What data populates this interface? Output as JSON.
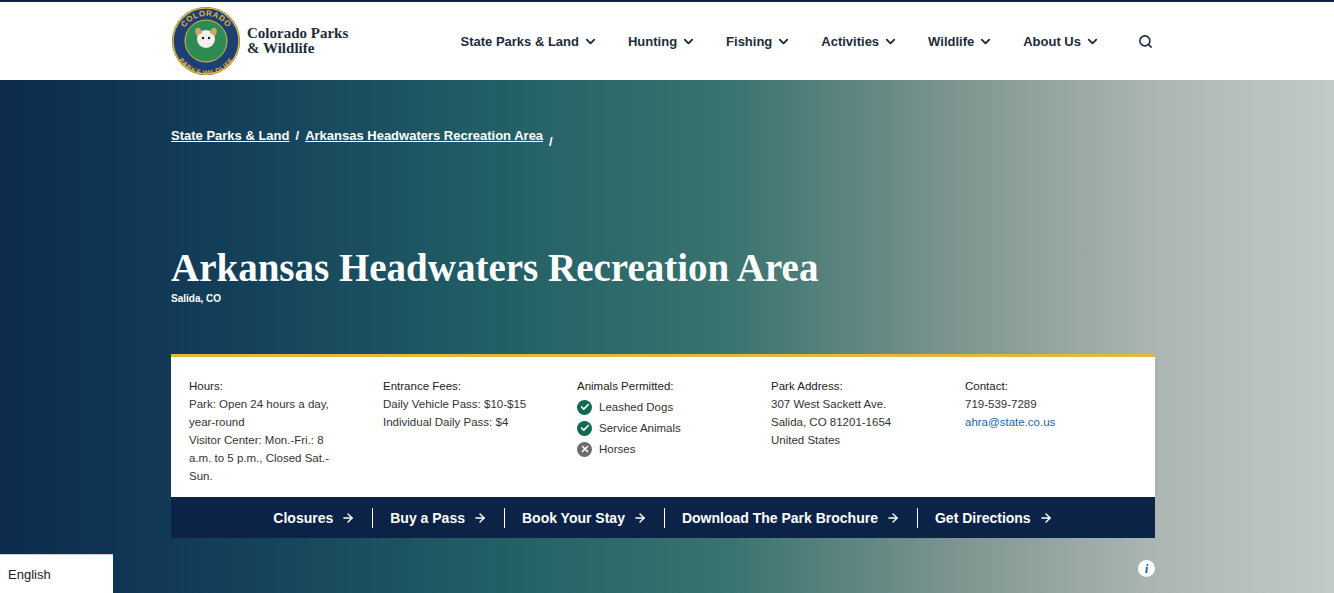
{
  "header": {
    "logo": {
      "ring_top": "COLORADO",
      "ring_bottom": "PARKS WILDLIFE",
      "lines": [
        "Colorado Parks",
        "& Wildlife"
      ]
    },
    "nav": [
      {
        "label": "State Parks & Land",
        "has_menu": true
      },
      {
        "label": "Hunting",
        "has_menu": true
      },
      {
        "label": "Fishing",
        "has_menu": true
      },
      {
        "label": "Activities",
        "has_menu": true
      },
      {
        "label": "Wildlife",
        "has_menu": true
      },
      {
        "label": "About Us",
        "has_menu": true
      }
    ]
  },
  "breadcrumb": {
    "items": [
      "State Parks & Land",
      "Arkansas Headwaters Recreation Area"
    ],
    "separator": "/",
    "trailing": "/"
  },
  "hero": {
    "title": "Arkansas Headwaters Recreation Area",
    "location": "Salida, CO"
  },
  "info": {
    "hours": {
      "label": "Hours:",
      "lines": [
        "Park:  Open 24 hours a day, year-round",
        "Visitor Center:  Mon.-Fri.: 8 a.m. to 5 p.m., Closed Sat.-Sun."
      ]
    },
    "fees": {
      "label": "Entrance Fees:",
      "lines": [
        "Daily Vehicle Pass: $10-$15",
        "Individual Daily Pass: $4"
      ]
    },
    "animals": {
      "label": "Animals Permitted:",
      "items": [
        {
          "label": "Leashed Dogs",
          "allowed": true
        },
        {
          "label": "Service Animals",
          "allowed": true
        },
        {
          "label": "Horses",
          "allowed": false
        }
      ]
    },
    "address": {
      "label": "Park Address:",
      "lines": [
        "307 West Sackett Ave.",
        "Salida, CO 81201-1654",
        "United States"
      ]
    },
    "contact": {
      "label": "Contact:",
      "phone": "719-539-7289",
      "email": "ahra@state.co.us"
    }
  },
  "actions": [
    "Closures",
    "Buy a Pass",
    "Book Your Stay",
    "Download The Park Brochure",
    "Get Directions"
  ],
  "language": "English",
  "info_button": "i"
}
